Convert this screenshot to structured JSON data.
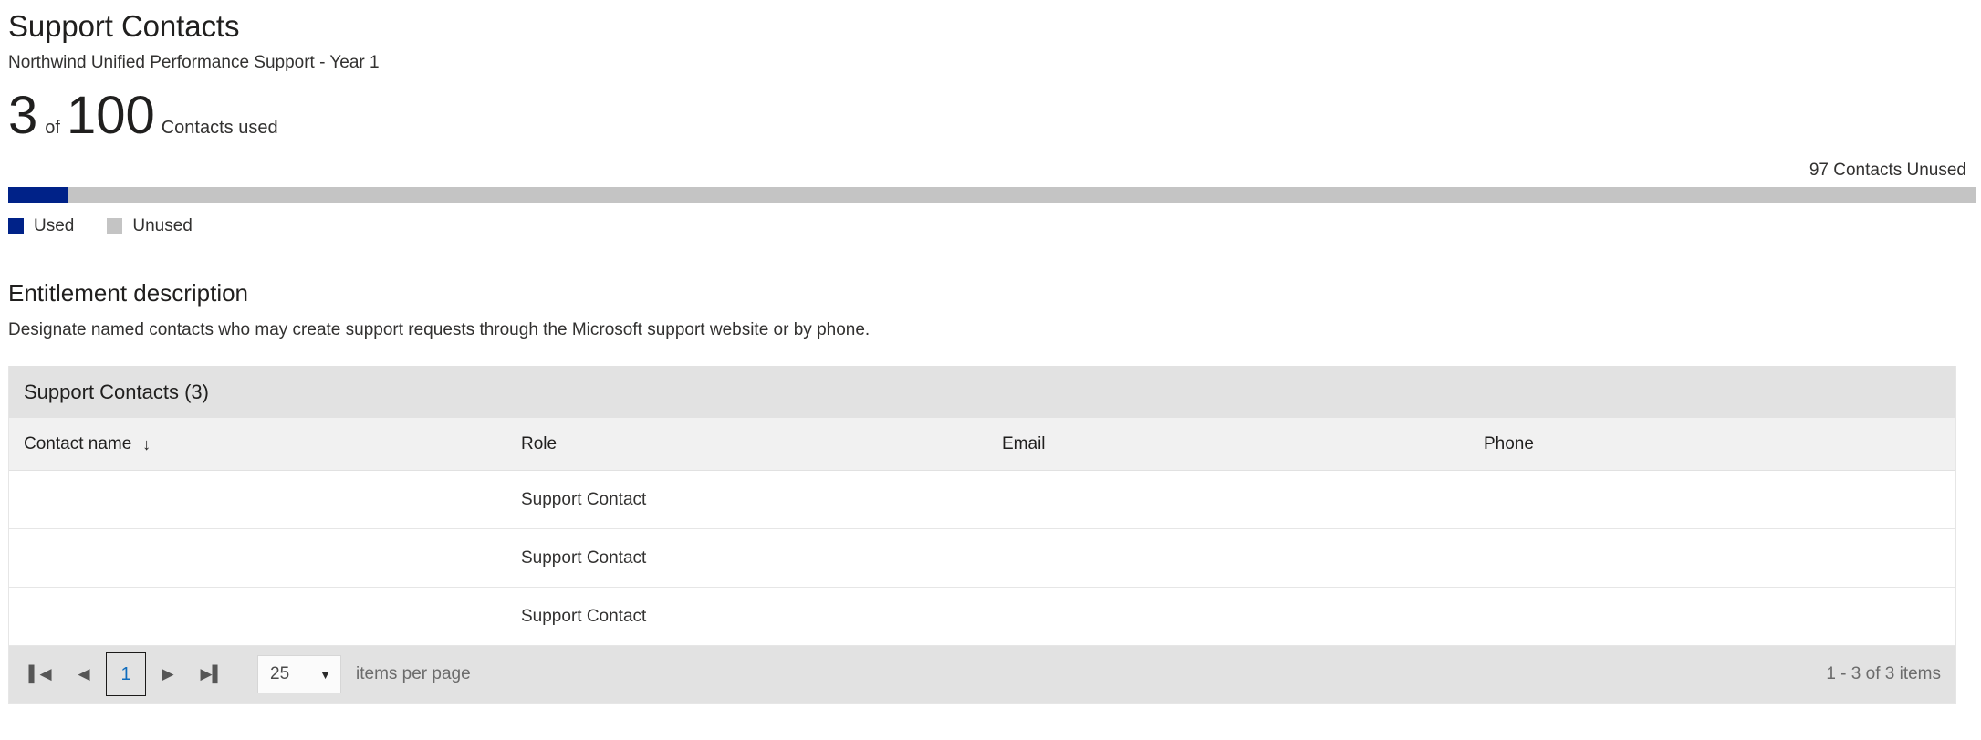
{
  "header": {
    "title": "Support Contacts",
    "subtitle": "Northwind Unified Performance Support - Year 1"
  },
  "usage": {
    "used": "3",
    "of": "of",
    "total": "100",
    "label": "Contacts used",
    "unused_caption": "97 Contacts Unused",
    "used_percent": 3,
    "colors": {
      "used": "#002288",
      "unused": "#c4c4c4"
    },
    "legend": [
      {
        "label": "Used",
        "color": "#002288",
        "name": "used"
      },
      {
        "label": "Unused",
        "color": "#c4c4c4",
        "name": "unused"
      }
    ]
  },
  "entitlement": {
    "title": "Entitlement description",
    "body": "Designate named contacts who may create support requests through the Microsoft support website or by phone."
  },
  "grid": {
    "title": "Support Contacts (3)",
    "sort_indicator": "↓",
    "columns": [
      {
        "key": "name",
        "label": "Contact name",
        "sorted": true
      },
      {
        "key": "role",
        "label": "Role",
        "sorted": false
      },
      {
        "key": "email",
        "label": "Email",
        "sorted": false
      },
      {
        "key": "phone",
        "label": "Phone",
        "sorted": false
      }
    ],
    "rows": [
      {
        "name": "",
        "role": "Support Contact",
        "email": "",
        "phone": ""
      },
      {
        "name": "",
        "role": "Support Contact",
        "email": "",
        "phone": ""
      },
      {
        "name": "",
        "role": "Support Contact",
        "email": "",
        "phone": ""
      }
    ]
  },
  "pager": {
    "first_icon": "▌◀",
    "prev_icon": "◀",
    "current_page": "1",
    "next_icon": "▶",
    "last_icon": "▶▌",
    "page_size": "25",
    "caret_icon": "▼",
    "items_per_page_label": "items per page",
    "range_label": "1 - 3 of 3 items"
  }
}
